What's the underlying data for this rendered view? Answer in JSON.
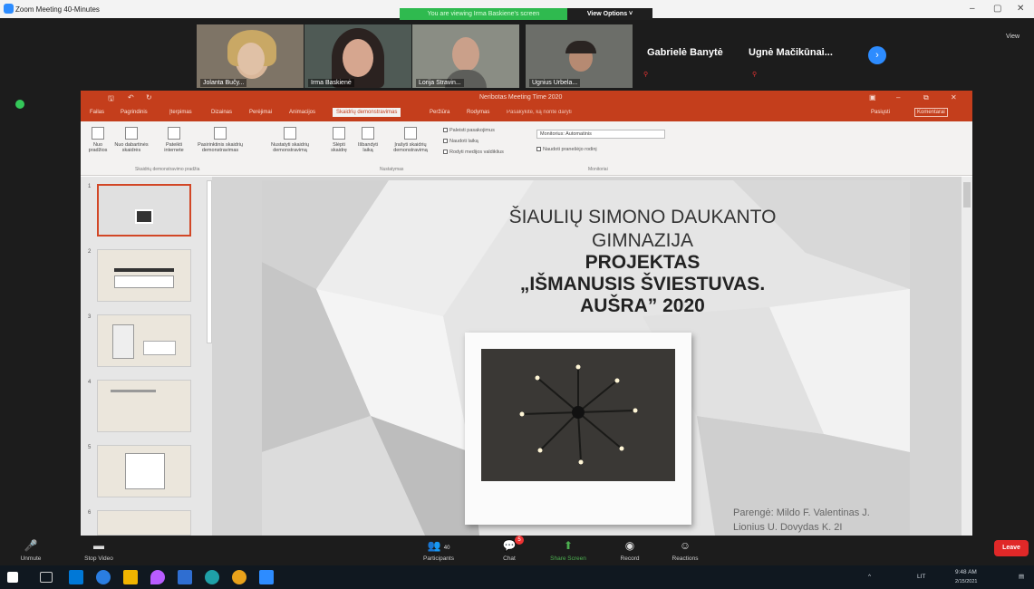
{
  "zoom": {
    "window_title": "Zoom Meeting 40-Minutes",
    "share_banner": "You are viewing Irma Baskiene's screen",
    "view_options": "View Options ˅",
    "view_button": "View",
    "participants": [
      {
        "name": "Jolanta Bučy..."
      },
      {
        "name": "Irma Baskienė"
      },
      {
        "name": "Lorija Stravin..."
      },
      {
        "name": "Ugnius Urbela..."
      }
    ],
    "name_cards": [
      "Gabrielė Banytė",
      "Ugnė Mačikūnai..."
    ],
    "toolbar": {
      "unmute": "Unmute",
      "stop_video": "Stop Video",
      "participants": "Participants",
      "participants_count": "40",
      "chat": "Chat",
      "chat_badge": "5",
      "share_screen": "Share Screen",
      "record": "Record",
      "reactions": "Reactions",
      "leave": "Leave"
    }
  },
  "powerpoint": {
    "title": "Neribotas Meeting Time 2020",
    "tabs": [
      "Failas",
      "Pagrindinis",
      "Įterpimas",
      "Dizainas",
      "Perėjimai",
      "Animacijos",
      "Skaidrių demonstravimas",
      "Peržiūra",
      "Rodymas",
      "Pasakykite, ką norite daryti"
    ],
    "share_label": "Pasiųsti",
    "comments_label": "Komentarai",
    "ribbon_buttons": [
      "Nuo pradžios",
      "Nuo dabartinės skaidrės",
      "Pateikti internete",
      "Pasirinktinis skaidrių demonstravimas",
      "Nustatyti skaidrių demonstravimą",
      "Slėpti skaidrę",
      "Išbandyti laiką",
      "Įrašyti skaidrių demonstravimą"
    ],
    "checkboxes": [
      "Paleisti pasakojimus",
      "Naudoti laiką",
      "Rodyti medijos valdiklius"
    ],
    "monitor_dropdown": "Monitorius: Automatinis",
    "presenter_view": "Naudoti pranešėjo rodinį",
    "group_labels": [
      "Skaidrių demonstravimo pradžia",
      "Nustatymas",
      "Monitoriai"
    ],
    "slide_numbers": [
      "1",
      "2",
      "3",
      "4",
      "5",
      "6"
    ],
    "slide": {
      "line1": "ŠIAULIŲ SIMONO DAUKANTO",
      "line2": "GIMNAZIJA",
      "line3": "PROJEKTAS",
      "line4": "„IŠMANUSIS  ŠVIESTUVAS.",
      "line5": "AUŠRA” 2020",
      "credits": "Parengė: Mildo F. Valentinas J.",
      "credits2": "Lionius U. Dovydas K. 2I"
    }
  },
  "taskbar": {
    "time": "9:48 AM",
    "date": "2/15/2021",
    "lang": "LIT"
  }
}
